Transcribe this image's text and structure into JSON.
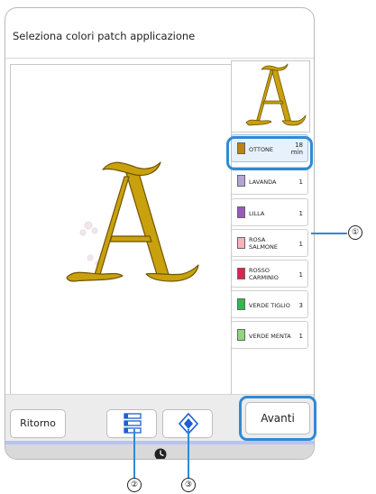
{
  "screen": {
    "title": "Seleziona colori patch applicazione"
  },
  "colors": [
    {
      "name": "OTTONE",
      "count": "18\nmin",
      "swatch": "#b8860b"
    },
    {
      "name": "LAVANDA",
      "count": "1",
      "swatch": "#b6a3d6"
    },
    {
      "name": "LILLA",
      "count": "1",
      "swatch": "#9b59b6"
    },
    {
      "name": "ROSA\nSALMONE",
      "count": "1",
      "swatch": "#f5b3ba"
    },
    {
      "name": "ROSSO\nCARMINIO",
      "count": "1",
      "swatch": "#e0234e"
    },
    {
      "name": "VERDE TIGLIO",
      "count": "3",
      "swatch": "#39b54a"
    },
    {
      "name": "VERDE MENTA",
      "count": "1",
      "swatch": "#8fd67c"
    }
  ],
  "buttons": {
    "back": "Ritorno",
    "next": "Avanti"
  },
  "callouts": {
    "one": "①",
    "two": "②",
    "three": "③"
  },
  "accent": "#2f8ad5",
  "icons": [
    "color-list-icon",
    "applique-outline-icon",
    "clock-icon"
  ]
}
